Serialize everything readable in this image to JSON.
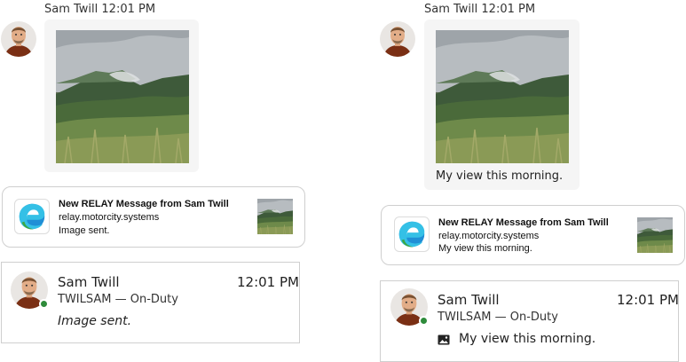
{
  "left": {
    "header": "Sam Twill 12:01 PM",
    "toast": {
      "title": "New RELAY Message from Sam Twill",
      "source": "relay.motorcity.systems",
      "body": "Image sent.",
      "app_icon": "edge-browser-icon"
    },
    "card": {
      "name": "Sam Twill",
      "time": "12:01 PM",
      "subtitle": "TWILSAM — On-Duty",
      "body": "Image sent."
    }
  },
  "right": {
    "header": "Sam Twill  12:01 PM",
    "caption": "My view this morning.",
    "toast": {
      "title": "New RELAY Message from Sam Twill",
      "source": "relay.motorcity.systems",
      "body": "My view this morning.",
      "app_icon": "edge-browser-icon"
    },
    "card": {
      "name": "Sam Twill",
      "time": "12:01 PM",
      "subtitle": "TWILSAM — On-Duty",
      "body": "My view this morning.",
      "body_icon": "image-icon"
    }
  },
  "colors": {
    "presence": "#2e8b3a",
    "bubble": "#f5f5f5",
    "border": "#cfcfcf"
  }
}
